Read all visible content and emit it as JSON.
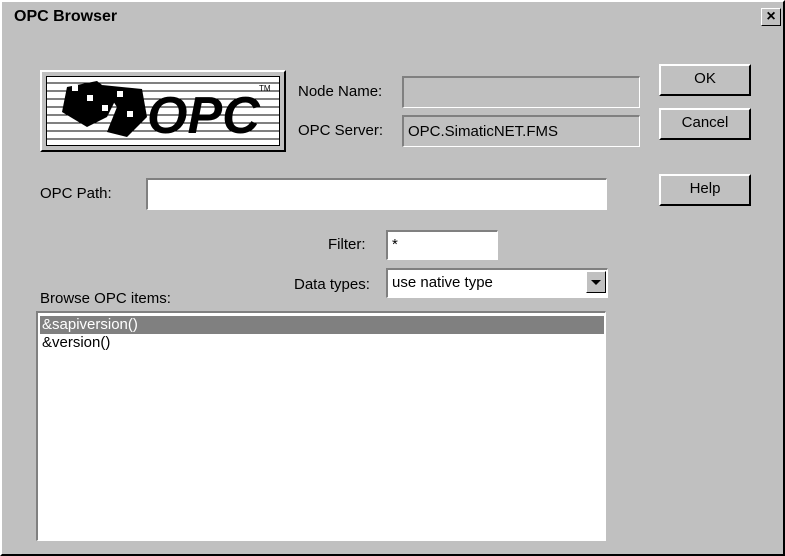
{
  "window": {
    "title": "OPC Browser",
    "close_glyph": "×"
  },
  "logo": {
    "text": "OPC"
  },
  "labels": {
    "node_name": "Node Name:",
    "opc_server": "OPC Server:",
    "opc_path": "OPC Path:",
    "filter": "Filter:",
    "data_types": "Data types:",
    "browse_items": "Browse OPC items:"
  },
  "fields": {
    "node_name": "",
    "opc_server": "OPC.SimaticNET.FMS",
    "opc_path": "",
    "filter": "*",
    "data_types": "use native type"
  },
  "buttons": {
    "ok": "OK",
    "cancel": "Cancel",
    "help": "Help"
  },
  "items": [
    "&sapiversion()",
    "&version()"
  ],
  "colors": {
    "face": "#c0c0c0",
    "selection": "#808080"
  }
}
